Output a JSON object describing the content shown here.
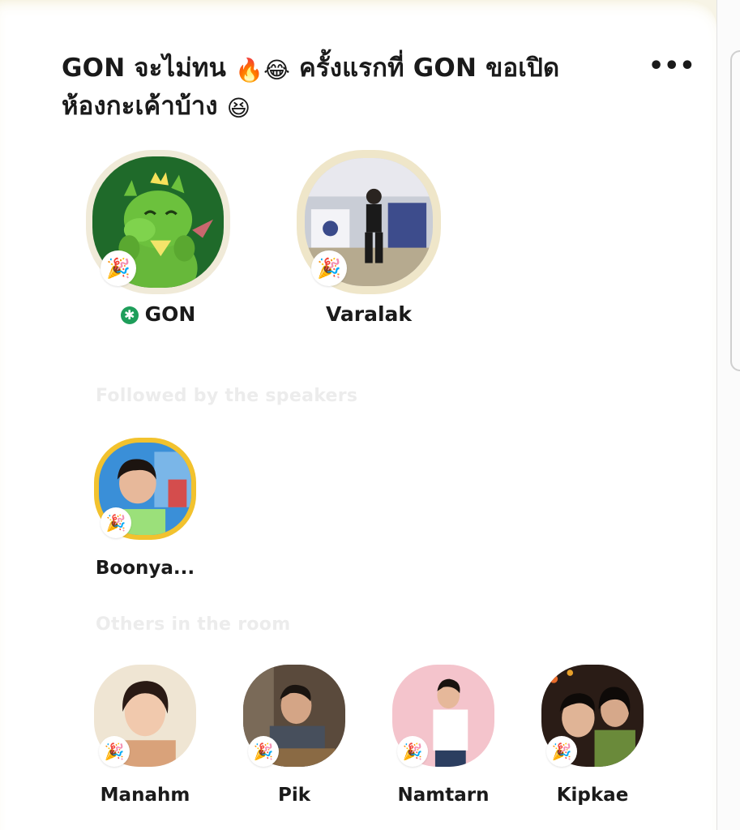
{
  "room": {
    "title_line1": "GON จะไม่ทน",
    "title_emoji1": "🔥😂",
    "title_line1b": "ครั้งแรกที่ GON ขอเปิด",
    "title_line2": "ห้องกะเค้าบ้าง",
    "title_emoji2": "😆",
    "more_label": "•••"
  },
  "speakers": [
    {
      "name": "GON",
      "moderator_icon": "✱",
      "badge": "🎉"
    },
    {
      "name": "Varalak",
      "badge": "🎉"
    }
  ],
  "sections": {
    "followed": "Followed by the speakers",
    "others": "Others in the room"
  },
  "followed": [
    {
      "name": "Boonya...",
      "badge": "🎉"
    }
  ],
  "others": [
    {
      "name": "Manahm",
      "badge": "🎉"
    },
    {
      "name": "Pik",
      "badge": "🎉"
    },
    {
      "name": "Namtarn",
      "badge": "🎉"
    },
    {
      "name": "Kipkae",
      "badge": "🎉"
    }
  ],
  "colors": {
    "moderator_green": "#1e9e5a",
    "header_tint": "#f7f4e6",
    "followed_ring": "#f2c22e"
  },
  "icons": {
    "badge": "party-popper-icon",
    "moderator": "moderator-star-icon",
    "more": "more-dots-icon"
  }
}
